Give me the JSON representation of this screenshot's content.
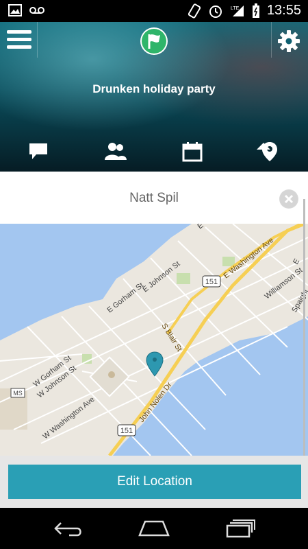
{
  "status_bar": {
    "time": "13:55",
    "network": "LTE"
  },
  "header": {
    "title": "Drunken holiday party"
  },
  "tabs": [
    {
      "name": "tab-chat",
      "icon": "chat-icon"
    },
    {
      "name": "tab-guests",
      "icon": "people-icon"
    },
    {
      "name": "tab-calendar",
      "icon": "calendar-icon"
    },
    {
      "name": "tab-location",
      "icon": "location-pin-icon",
      "active": true
    }
  ],
  "location": {
    "name": "Natt Spil"
  },
  "map": {
    "streets": {
      "e_washington": "E Washington Ave",
      "e_johnson": "E Johnson St",
      "e_gorham": "E Gorham St",
      "williamson": "Williamson St",
      "s_blair": "S Blair St",
      "w_gorham": "W Gorham St",
      "w_johnson": "W Johnson St",
      "w_washington": "W Washington Ave",
      "john_nolen": "John Nolen Dr",
      "e_st": "E",
      "e_st2": "E",
      "spaight": "Spaight"
    },
    "route_151_a": "151",
    "route_151_b": "151",
    "ms_label": "MS"
  },
  "actions": {
    "edit_location": "Edit Location"
  },
  "colors": {
    "accent": "#2a9fb5",
    "map_land": "#ebe7df",
    "map_water": "#a3c6f0",
    "road_major": "#f6cf54",
    "pin": "#2d98b0"
  }
}
